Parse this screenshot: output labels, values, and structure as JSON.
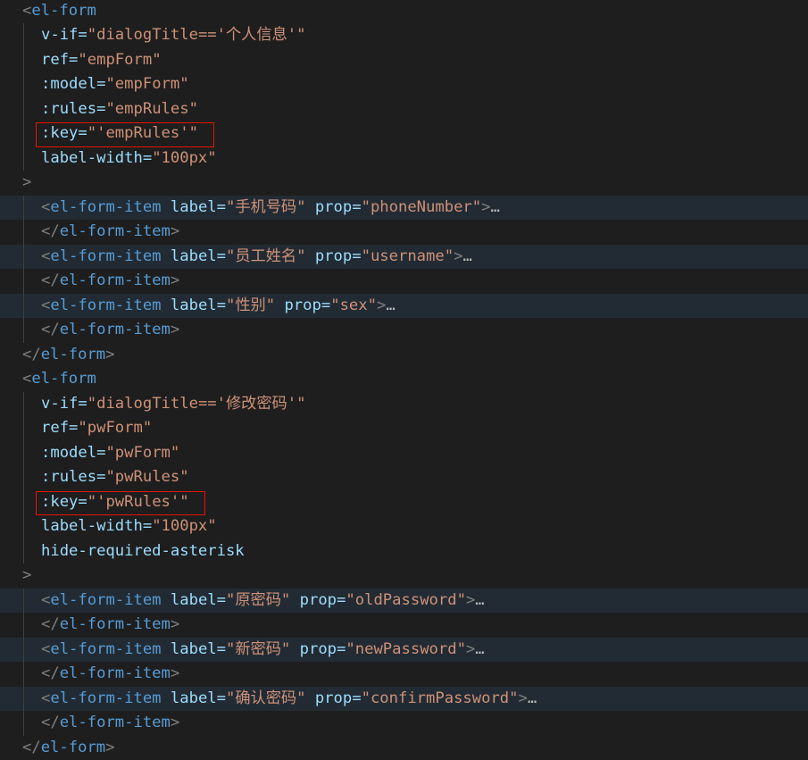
{
  "lines": [
    {
      "indent": 0,
      "hl": false,
      "tokens": [
        {
          "t": "<",
          "c": "br"
        },
        {
          "t": "el-form",
          "c": "tag"
        }
      ]
    },
    {
      "indent": 1,
      "hl": false,
      "tokens": [
        {
          "t": "v-if",
          "c": "attr"
        },
        {
          "t": "=",
          "c": "attr"
        },
        {
          "t": "\"dialogTitle=='个人信息'\"",
          "c": "str"
        }
      ]
    },
    {
      "indent": 1,
      "hl": false,
      "tokens": [
        {
          "t": "ref",
          "c": "attr"
        },
        {
          "t": "=",
          "c": "attr"
        },
        {
          "t": "\"empForm\"",
          "c": "str"
        }
      ]
    },
    {
      "indent": 1,
      "hl": false,
      "tokens": [
        {
          "t": ":model",
          "c": "attr"
        },
        {
          "t": "=",
          "c": "attr"
        },
        {
          "t": "\"empForm\"",
          "c": "str"
        }
      ]
    },
    {
      "indent": 1,
      "hl": false,
      "tokens": [
        {
          "t": ":rules",
          "c": "attr"
        },
        {
          "t": "=",
          "c": "attr"
        },
        {
          "t": "\"empRules\"",
          "c": "str"
        }
      ]
    },
    {
      "indent": 1,
      "hl": false,
      "boxed": true,
      "tokens": [
        {
          "t": ":key",
          "c": "attr"
        },
        {
          "t": "=",
          "c": "attr"
        },
        {
          "t": "\"'empRules'\"",
          "c": "str"
        }
      ]
    },
    {
      "indent": 1,
      "hl": false,
      "tokens": [
        {
          "t": "label-width",
          "c": "attr"
        },
        {
          "t": "=",
          "c": "attr"
        },
        {
          "t": "\"100px\"",
          "c": "str"
        }
      ]
    },
    {
      "indent": 0,
      "hl": false,
      "tokens": [
        {
          "t": ">",
          "c": "br"
        }
      ]
    },
    {
      "indent": 1,
      "hl": true,
      "tokens": [
        {
          "t": "<",
          "c": "br"
        },
        {
          "t": "el-form-item",
          "c": "tag"
        },
        {
          "t": " ",
          "c": "attr"
        },
        {
          "t": "label",
          "c": "attr"
        },
        {
          "t": "=",
          "c": "attr"
        },
        {
          "t": "\"手机号码\"",
          "c": "str"
        },
        {
          "t": " ",
          "c": "attr"
        },
        {
          "t": "prop",
          "c": "attr"
        },
        {
          "t": "=",
          "c": "attr"
        },
        {
          "t": "\"phoneNumber\"",
          "c": "str"
        },
        {
          "t": ">",
          "c": "br"
        },
        {
          "t": "…",
          "c": "ell"
        }
      ]
    },
    {
      "indent": 1,
      "hl": false,
      "tokens": [
        {
          "t": "</",
          "c": "br"
        },
        {
          "t": "el-form-item",
          "c": "tag"
        },
        {
          "t": ">",
          "c": "br"
        }
      ]
    },
    {
      "indent": 1,
      "hl": true,
      "tokens": [
        {
          "t": "<",
          "c": "br"
        },
        {
          "t": "el-form-item",
          "c": "tag"
        },
        {
          "t": " ",
          "c": "attr"
        },
        {
          "t": "label",
          "c": "attr"
        },
        {
          "t": "=",
          "c": "attr"
        },
        {
          "t": "\"员工姓名\"",
          "c": "str"
        },
        {
          "t": " ",
          "c": "attr"
        },
        {
          "t": "prop",
          "c": "attr"
        },
        {
          "t": "=",
          "c": "attr"
        },
        {
          "t": "\"username\"",
          "c": "str"
        },
        {
          "t": ">",
          "c": "br"
        },
        {
          "t": "…",
          "c": "ell"
        }
      ]
    },
    {
      "indent": 1,
      "hl": false,
      "tokens": [
        {
          "t": "</",
          "c": "br"
        },
        {
          "t": "el-form-item",
          "c": "tag"
        },
        {
          "t": ">",
          "c": "br"
        }
      ]
    },
    {
      "indent": 1,
      "hl": true,
      "tokens": [
        {
          "t": "<",
          "c": "br"
        },
        {
          "t": "el-form-item",
          "c": "tag"
        },
        {
          "t": " ",
          "c": "attr"
        },
        {
          "t": "label",
          "c": "attr"
        },
        {
          "t": "=",
          "c": "attr"
        },
        {
          "t": "\"性别\"",
          "c": "str"
        },
        {
          "t": " ",
          "c": "attr"
        },
        {
          "t": "prop",
          "c": "attr"
        },
        {
          "t": "=",
          "c": "attr"
        },
        {
          "t": "\"sex\"",
          "c": "str"
        },
        {
          "t": ">",
          "c": "br"
        },
        {
          "t": "…",
          "c": "ell"
        }
      ]
    },
    {
      "indent": 1,
      "hl": false,
      "tokens": [
        {
          "t": "</",
          "c": "br"
        },
        {
          "t": "el-form-item",
          "c": "tag"
        },
        {
          "t": ">",
          "c": "br"
        }
      ]
    },
    {
      "indent": 0,
      "hl": false,
      "tokens": [
        {
          "t": "</",
          "c": "br"
        },
        {
          "t": "el-form",
          "c": "tag"
        },
        {
          "t": ">",
          "c": "br"
        }
      ]
    },
    {
      "indent": 0,
      "hl": false,
      "tokens": [
        {
          "t": "<",
          "c": "br"
        },
        {
          "t": "el-form",
          "c": "tag"
        }
      ]
    },
    {
      "indent": 1,
      "hl": false,
      "tokens": [
        {
          "t": "v-if",
          "c": "attr"
        },
        {
          "t": "=",
          "c": "attr"
        },
        {
          "t": "\"dialogTitle=='修改密码'\"",
          "c": "str"
        }
      ]
    },
    {
      "indent": 1,
      "hl": false,
      "tokens": [
        {
          "t": "ref",
          "c": "attr"
        },
        {
          "t": "=",
          "c": "attr"
        },
        {
          "t": "\"pwForm\"",
          "c": "str"
        }
      ]
    },
    {
      "indent": 1,
      "hl": false,
      "tokens": [
        {
          "t": ":model",
          "c": "attr"
        },
        {
          "t": "=",
          "c": "attr"
        },
        {
          "t": "\"pwForm\"",
          "c": "str"
        }
      ]
    },
    {
      "indent": 1,
      "hl": false,
      "tokens": [
        {
          "t": ":rules",
          "c": "attr"
        },
        {
          "t": "=",
          "c": "attr"
        },
        {
          "t": "\"pwRules\"",
          "c": "str"
        }
      ]
    },
    {
      "indent": 1,
      "hl": false,
      "boxed": true,
      "tokens": [
        {
          "t": ":key",
          "c": "attr"
        },
        {
          "t": "=",
          "c": "attr"
        },
        {
          "t": "\"'pwRules'\"",
          "c": "str"
        }
      ]
    },
    {
      "indent": 1,
      "hl": false,
      "tokens": [
        {
          "t": "label-width",
          "c": "attr"
        },
        {
          "t": "=",
          "c": "attr"
        },
        {
          "t": "\"100px\"",
          "c": "str"
        }
      ]
    },
    {
      "indent": 1,
      "hl": false,
      "tokens": [
        {
          "t": "hide-required-asterisk",
          "c": "attr"
        }
      ]
    },
    {
      "indent": 0,
      "hl": false,
      "tokens": [
        {
          "t": ">",
          "c": "br"
        }
      ]
    },
    {
      "indent": 1,
      "hl": true,
      "tokens": [
        {
          "t": "<",
          "c": "br"
        },
        {
          "t": "el-form-item",
          "c": "tag"
        },
        {
          "t": " ",
          "c": "attr"
        },
        {
          "t": "label",
          "c": "attr"
        },
        {
          "t": "=",
          "c": "attr"
        },
        {
          "t": "\"原密码\"",
          "c": "str"
        },
        {
          "t": " ",
          "c": "attr"
        },
        {
          "t": "prop",
          "c": "attr"
        },
        {
          "t": "=",
          "c": "attr"
        },
        {
          "t": "\"oldPassword\"",
          "c": "str"
        },
        {
          "t": ">",
          "c": "br"
        },
        {
          "t": "…",
          "c": "ell"
        }
      ]
    },
    {
      "indent": 1,
      "hl": false,
      "tokens": [
        {
          "t": "</",
          "c": "br"
        },
        {
          "t": "el-form-item",
          "c": "tag"
        },
        {
          "t": ">",
          "c": "br"
        }
      ]
    },
    {
      "indent": 1,
      "hl": true,
      "tokens": [
        {
          "t": "<",
          "c": "br"
        },
        {
          "t": "el-form-item",
          "c": "tag"
        },
        {
          "t": " ",
          "c": "attr"
        },
        {
          "t": "label",
          "c": "attr"
        },
        {
          "t": "=",
          "c": "attr"
        },
        {
          "t": "\"新密码\"",
          "c": "str"
        },
        {
          "t": " ",
          "c": "attr"
        },
        {
          "t": "prop",
          "c": "attr"
        },
        {
          "t": "=",
          "c": "attr"
        },
        {
          "t": "\"newPassword\"",
          "c": "str"
        },
        {
          "t": ">",
          "c": "br"
        },
        {
          "t": "…",
          "c": "ell"
        }
      ]
    },
    {
      "indent": 1,
      "hl": false,
      "tokens": [
        {
          "t": "</",
          "c": "br"
        },
        {
          "t": "el-form-item",
          "c": "tag"
        },
        {
          "t": ">",
          "c": "br"
        }
      ]
    },
    {
      "indent": 1,
      "hl": true,
      "tokens": [
        {
          "t": "<",
          "c": "br"
        },
        {
          "t": "el-form-item",
          "c": "tag"
        },
        {
          "t": " ",
          "c": "attr"
        },
        {
          "t": "label",
          "c": "attr"
        },
        {
          "t": "=",
          "c": "attr"
        },
        {
          "t": "\"确认密码\"",
          "c": "str"
        },
        {
          "t": " ",
          "c": "attr"
        },
        {
          "t": "prop",
          "c": "attr"
        },
        {
          "t": "=",
          "c": "attr"
        },
        {
          "t": "\"confirmPassword\"",
          "c": "str"
        },
        {
          "t": ">",
          "c": "br"
        },
        {
          "t": "…",
          "c": "ell"
        }
      ]
    },
    {
      "indent": 1,
      "hl": false,
      "tokens": [
        {
          "t": "</",
          "c": "br"
        },
        {
          "t": "el-form-item",
          "c": "tag"
        },
        {
          "t": ">",
          "c": "br"
        }
      ]
    },
    {
      "indent": 0,
      "hl": false,
      "tokens": [
        {
          "t": "</",
          "c": "br"
        },
        {
          "t": "el-form",
          "c": "tag"
        },
        {
          "t": ">",
          "c": "br"
        }
      ]
    }
  ]
}
